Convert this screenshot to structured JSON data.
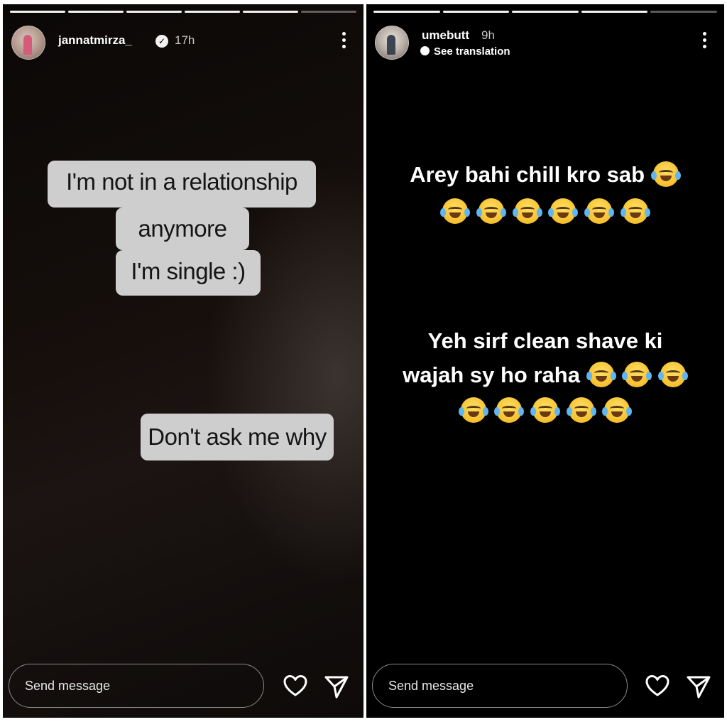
{
  "left_story": {
    "username": "jannatmirza_",
    "time": "17h",
    "verified_icon": "verified-badge-icon",
    "sticker_lines": [
      "I'm not in a relationship",
      "anymore",
      "I'm single :)"
    ],
    "sticker2": "Don't ask me why",
    "message_placeholder": "Send message"
  },
  "right_story": {
    "username": "umebutt",
    "time": "9h",
    "see_translation": "See translation",
    "caption1_text": "Arey bahi chill kro sab",
    "caption2_line1": "Yeh sirf clean shave ki",
    "caption2_line2_text": "wajah sy ho raha",
    "emoji_name": "face-with-tears-of-joy",
    "message_placeholder": "Send message"
  },
  "icons": [
    "heart-icon",
    "send-icon",
    "more-options-icon",
    "globe-icon"
  ]
}
